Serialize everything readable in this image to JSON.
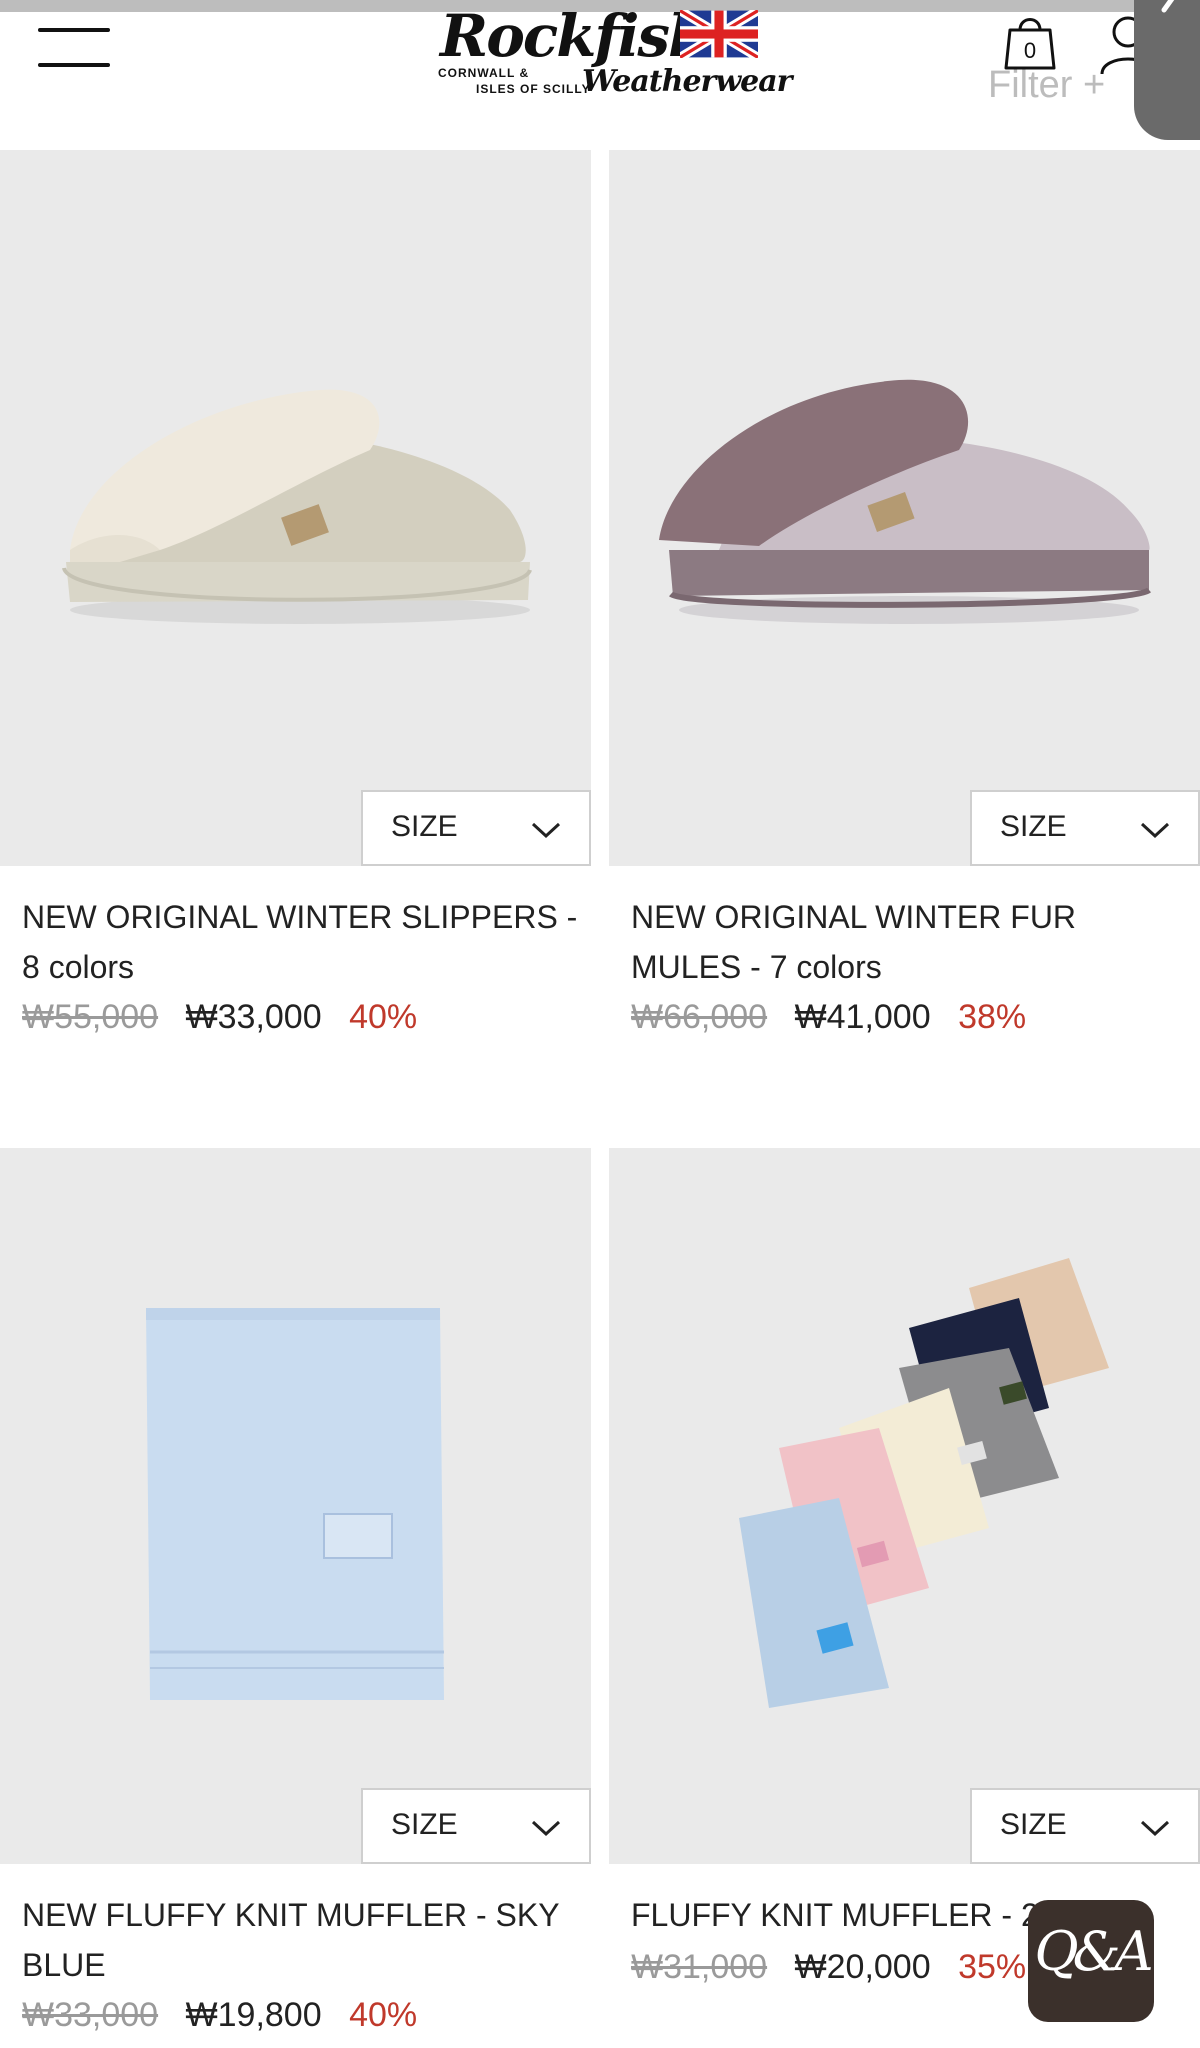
{
  "header": {
    "brand": "Rockfish",
    "brand_sub_line1": "CORNWALL &",
    "brand_sub_line2": "ISLES OF SCILLY",
    "brand_script": "Weatherwear",
    "cart_count": "0",
    "filter_label": "Filter +"
  },
  "products": [
    {
      "name": "NEW ORIGINAL WINTER SLIPPERS - 8 colors",
      "size_label": "SIZE",
      "original_price": "₩55,000",
      "sale_price": "₩33,000",
      "discount": "40%"
    },
    {
      "name": "NEW ORIGINAL WINTER FUR MULES - 7 colors",
      "size_label": "SIZE",
      "original_price": "₩66,000",
      "sale_price": "₩41,000",
      "discount": "38%"
    },
    {
      "name": "NEW FLUFFY KNIT MUFFLER - SKY BLUE",
      "size_label": "SIZE",
      "original_price": "₩33,000",
      "sale_price": "₩19,800",
      "discount": "40%"
    },
    {
      "name": "FLUFFY KNIT MUFFLER - 2c",
      "size_label": "SIZE",
      "original_price": "₩31,000",
      "sale_price": "₩20,000",
      "discount": "35%"
    }
  ],
  "qa_label": "Q&A",
  "colors": {
    "discount": "#c0392b",
    "original_price": "#9a9a9a",
    "image_bg": "#eaeaea",
    "qa_bg": "#3b302b"
  },
  "icons": [
    "menu-icon",
    "uk-flag-icon",
    "shopping-bag-icon",
    "user-icon",
    "back-chevron-icon",
    "chevron-down-icon"
  ]
}
